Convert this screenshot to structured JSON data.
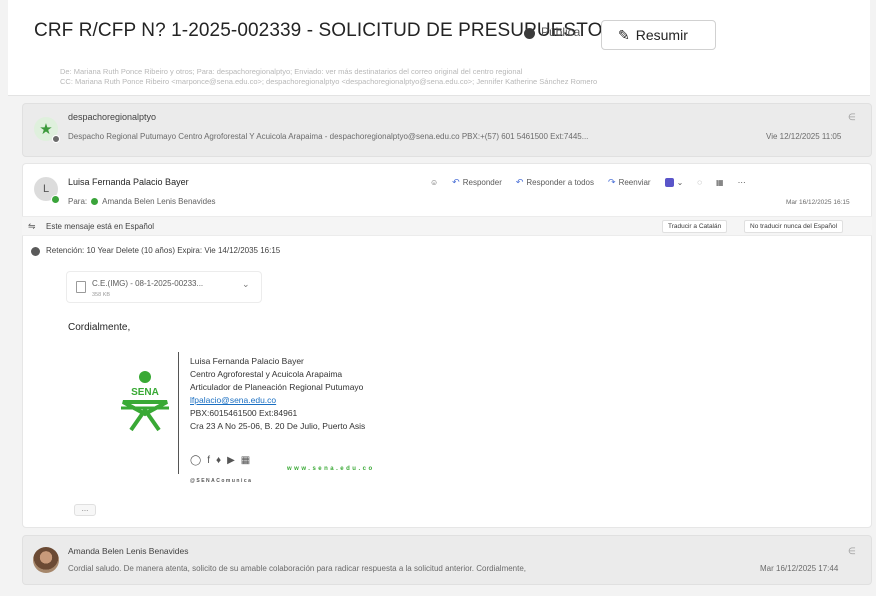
{
  "header": {
    "subject": "CRF R/CFP N? 1-2025-002339 - SOLICITUD DE PRESUPUESTO",
    "visibility": "Pública",
    "resumir_label": "Resumir",
    "faded_line_1": "De: Mariana Ruth Ponce Ribeiro y otros; Para: despachoregionalptyo; Enviado: ver más destinatarios del correo original del centro regional",
    "faded_line_2": "CC: Mariana Ruth Ponce Ribeiro <marponce@sena.edu.co>; despachoregionalptyo <despachoregionalptyo@sena.edu.co>; Jennifer Katherine Sánchez Romero"
  },
  "message1": {
    "from": "despachoregionalptyo",
    "preview": "Despacho Regional Putumayo Centro Agroforestal Y Acuicola Arapaima - despachoregionalptyo@sena.edu.co PBX:+(57) 601 5461500 Ext:7445...",
    "date": "Vie 12/12/2025 11:05"
  },
  "message2": {
    "avatar_initial": "L",
    "from": "Luisa Fernanda Palacio Bayer",
    "to_label": "Para:",
    "to_name": "Amanda Belen Lenis Benavides",
    "actions": {
      "reply": "Responder",
      "reply_all": "Responder a todos",
      "forward": "Reenviar"
    },
    "date": "Mar 16/12/2025 16:15",
    "translate_text": "Este mensaje está en Español",
    "translate_button": "Traducir a Catalán",
    "no_translate_button": "No traducir nunca del Español",
    "retention": "Retención: 10 Year Delete (10 años) Expira: Vie 14/12/2035 16:15",
    "attachment_name": "C.E.(IMG) - 08-1-2025-00233...",
    "attachment_size": "358 KB",
    "greeting": "Cordialmente,",
    "logo_text": "SENA",
    "signature": {
      "name": "Luisa Fernanda Palacio Bayer",
      "center": "Centro Agroforestal y Acuicola Arapaima",
      "role": "Articulador de Planeación Regional Putumayo",
      "email": "lfpalacio@sena.edu.co",
      "phone": "PBX:6015461500 Ext:84961",
      "address": "Cra 23 A No 25-06, B. 20 De Julio, Puerto Asis",
      "web": "www.sena.edu.co",
      "handle": "@SENAComunica"
    },
    "more_label": "..."
  },
  "message3": {
    "from": "Amanda Belen Lenis Benavides",
    "preview": "Cordial saludo. De manera atenta, solicito de su amable colaboración para radicar respuesta a la solicitud anterior. Cordialmente,",
    "date": "Mar 16/12/2025 17:44"
  },
  "icons": [
    "star-icon",
    "paperclip-icon",
    "sparkle-icon",
    "reply-icon",
    "reply-all-icon",
    "forward-icon",
    "teams-icon",
    "translate-icon",
    "retention-icon",
    "file-icon",
    "chevron-down-icon",
    "instagram-icon",
    "facebook-icon",
    "twitter-icon",
    "youtube-icon",
    "linkedin-icon"
  ],
  "colors": {
    "presence_green": "#3aa43a",
    "sena_green": "#39a935",
    "link_blue": "#1a6fc2",
    "action_blue": "#4a6fd6"
  }
}
